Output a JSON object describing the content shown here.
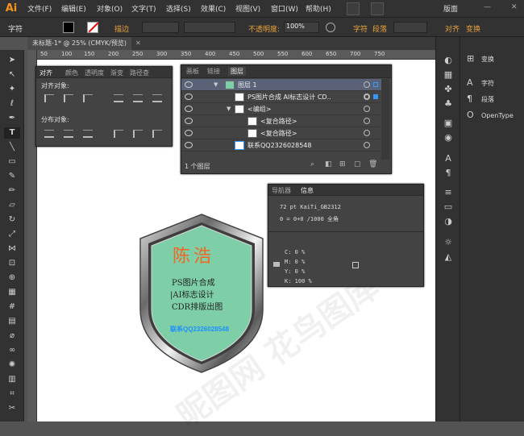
{
  "app": {
    "logo": "Ai"
  },
  "menu": [
    "文件(F)",
    "编辑(E)",
    "对象(O)",
    "文字(T)",
    "选择(S)",
    "效果(C)",
    "视图(V)",
    "窗口(W)",
    "帮助(H)"
  ],
  "workspace": "版面",
  "control": {
    "tool_label": "字符",
    "stroke_label": "描边",
    "opacity_label": "不透明度:",
    "opacity_value": "100%",
    "char_label": "字符",
    "para_label": "段落",
    "align_label": "对齐",
    "transform_label": "变换"
  },
  "document_tab": "未标题-1* @ 25% (CMYK/预览)",
  "ruler": [
    "50",
    "100",
    "150",
    "200",
    "250",
    "300",
    "350",
    "400",
    "450",
    "500",
    "550",
    "600",
    "650",
    "700",
    "750"
  ],
  "align_panel": {
    "tabs": [
      "对齐",
      "颜色",
      "透明度",
      "渐变",
      "路径查"
    ],
    "align_objects": "对齐对象:",
    "distribute_objects": "分布对象:"
  },
  "layers_panel": {
    "tabs": [
      "画板",
      "链接",
      "图层"
    ],
    "rows": [
      {
        "name": "图层 1"
      },
      {
        "name": "PS图片合成 AI标志设计 CD.."
      },
      {
        "name": "<编组>"
      },
      {
        "name": "<复合路径>"
      },
      {
        "name": "<复合路径>"
      },
      {
        "name": "联系QQ2326028548"
      }
    ],
    "footer": "1 个图层"
  },
  "info_panel": {
    "tabs": [
      "导航器",
      "信息"
    ],
    "font_line": "72 pt KaiTi_GB2312",
    "chars_line": "0 = 0+0 /1000 全角",
    "cmyk": [
      "C: 0 %",
      "M: 0 %",
      "Y: 0 %",
      "K: 100 %"
    ]
  },
  "right_dock": {
    "items": [
      "变换",
      "字符",
      "段落",
      "OpenType"
    ]
  },
  "badge": {
    "title": "陈浩",
    "lines": [
      "PS图片合成",
      "|AI标志设计",
      "CDR排版出图"
    ],
    "contact": "联系QQ2326028548",
    "fill_color": "#7ecfa8",
    "title_color": "#f26522",
    "contact_color": "#1e90ff"
  },
  "watermark": "昵图网 花鸟图库"
}
